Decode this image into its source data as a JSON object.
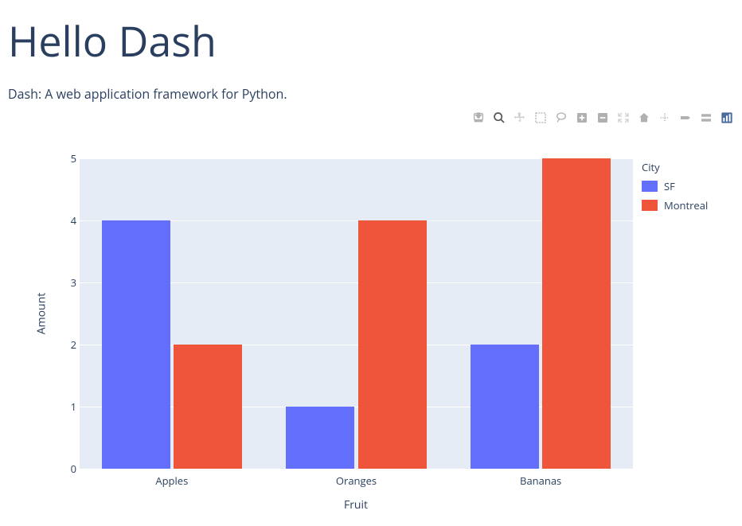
{
  "header": {
    "title": "Hello Dash",
    "subtitle": "Dash: A web application framework for Python."
  },
  "toolbar": {
    "download": "Download plot as a png",
    "zoom": "Zoom",
    "pan": "Pan",
    "select": "Box Select",
    "lasso": "Lasso Select",
    "zoomin": "Zoom in",
    "zoomout": "Zoom out",
    "autoscale": "Autoscale",
    "reset": "Reset axes",
    "spike": "Toggle Spike Lines",
    "hoverclosest": "Show closest data on hover",
    "hovercompare": "Compare data on hover",
    "plotly": "Produced with Plotly"
  },
  "chart_data": {
    "type": "bar",
    "categories": [
      "Apples",
      "Oranges",
      "Bananas"
    ],
    "series": [
      {
        "name": "SF",
        "values": [
          4,
          1,
          2
        ],
        "color": "#636efa"
      },
      {
        "name": "Montreal",
        "values": [
          2,
          4,
          5
        ],
        "color": "#ef553b"
      }
    ],
    "xlabel": "Fruit",
    "ylabel": "Amount",
    "ylim": [
      0,
      5
    ],
    "yticks": [
      0,
      1,
      2,
      3,
      4,
      5
    ],
    "legend_title": "City"
  }
}
